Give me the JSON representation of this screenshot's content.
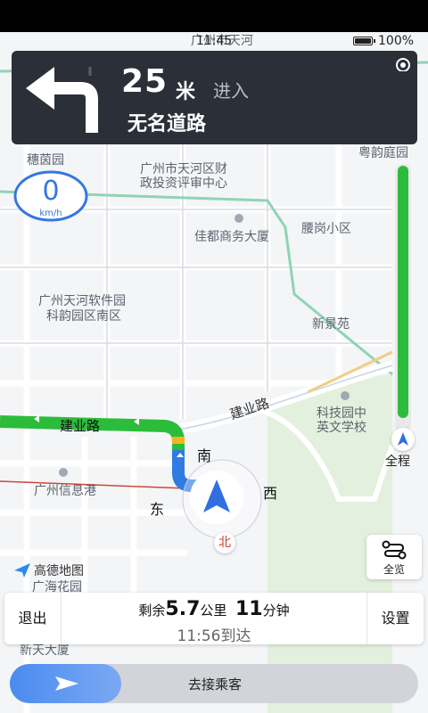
{
  "status": {
    "time": "11:45",
    "battery": "100%"
  },
  "guidance": {
    "distance": "25",
    "unit": "米",
    "action": "进入",
    "road": "无名道路"
  },
  "speed": {
    "value": "0",
    "unit": "km/h"
  },
  "map": {
    "labels": [
      "广州市天河",
      "穗茵园",
      "广州市天河区财",
      "政投资评审中心",
      "佳都商务大厦",
      "粤韵庭园",
      "腰岗小区",
      "广州天河软件园",
      "科韵园区南区",
      "新景苑",
      "建业路",
      "建业路",
      "科技园中",
      "英文学校",
      "广州信息港",
      "广海花园",
      "新天大厦"
    ],
    "compass": {
      "south": "南",
      "east": "东",
      "west": "西",
      "north": "北"
    },
    "brand": "高德地图"
  },
  "progress": {
    "label": "全程",
    "fill": 0.95
  },
  "overview": {
    "label": "全览"
  },
  "summary": {
    "exit": "退出",
    "settings": "设置",
    "remain_prefix": "剩余",
    "distance": "5.7",
    "distance_unit": "公里",
    "minutes": "11",
    "minutes_unit": "分钟",
    "eta": "11:56到达"
  },
  "passenger": {
    "label": "去接乘客"
  },
  "colors": {
    "card": "#2b2f38",
    "route": "#2cbc3b",
    "accent": "#3476e3"
  }
}
